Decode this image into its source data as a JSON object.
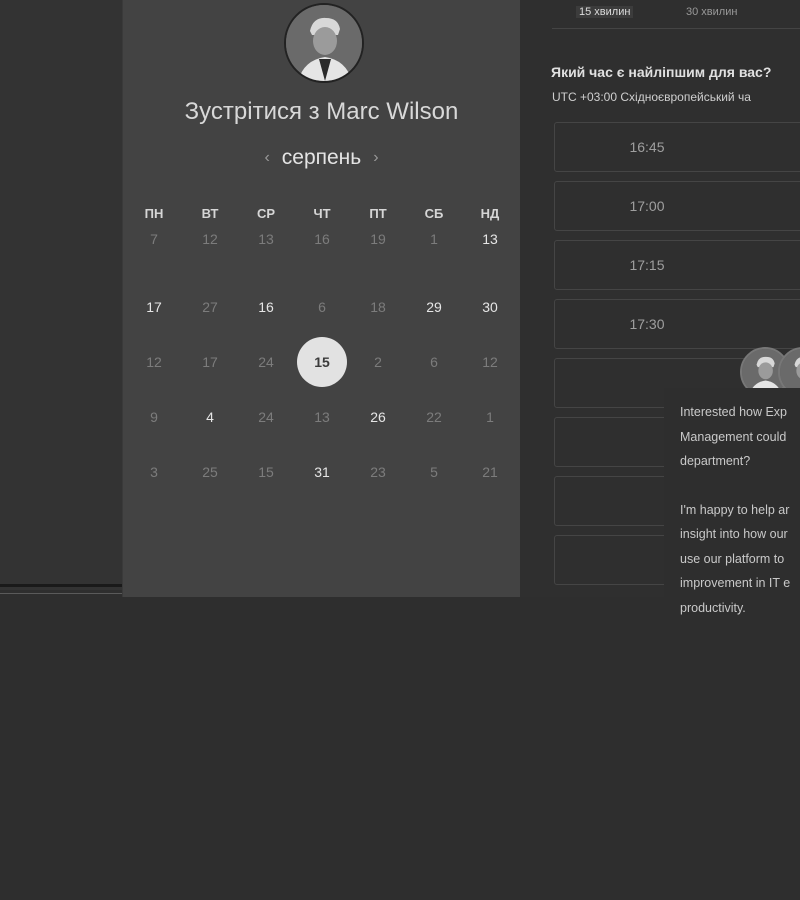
{
  "scheduler": {
    "title": "Зустрітися з Marc Wilson",
    "month": "серпень",
    "weekdays": [
      "ПН",
      "ВТ",
      "СР",
      "ЧТ",
      "ПТ",
      "СБ",
      "НД"
    ],
    "days": [
      [
        {
          "v": "7",
          "a": false
        },
        {
          "v": "12",
          "a": false
        },
        {
          "v": "13",
          "a": false
        },
        {
          "v": "16",
          "a": false
        },
        {
          "v": "19",
          "a": false
        },
        {
          "v": "1",
          "a": false
        },
        {
          "v": "13",
          "a": true
        }
      ],
      [
        {
          "v": "17",
          "a": true
        },
        {
          "v": "27",
          "a": false
        },
        {
          "v": "16",
          "a": true
        },
        {
          "v": "6",
          "a": false
        },
        {
          "v": "18",
          "a": false
        },
        {
          "v": "29",
          "a": true
        },
        {
          "v": "30",
          "a": true
        }
      ],
      [
        {
          "v": "12",
          "a": false
        },
        {
          "v": "17",
          "a": false
        },
        {
          "v": "24",
          "a": false
        },
        {
          "v": "15",
          "a": true,
          "selected": true
        },
        {
          "v": "2",
          "a": false
        },
        {
          "v": "6",
          "a": false
        },
        {
          "v": "12",
          "a": false
        }
      ],
      [
        {
          "v": "9",
          "a": false
        },
        {
          "v": "4",
          "a": true
        },
        {
          "v": "24",
          "a": false
        },
        {
          "v": "13",
          "a": false
        },
        {
          "v": "26",
          "a": true
        },
        {
          "v": "22",
          "a": false
        },
        {
          "v": "1",
          "a": false
        }
      ],
      [
        {
          "v": "3",
          "a": false
        },
        {
          "v": "25",
          "a": false
        },
        {
          "v": "15",
          "a": false
        },
        {
          "v": "31",
          "a": true
        },
        {
          "v": "23",
          "a": false
        },
        {
          "v": "5",
          "a": false
        },
        {
          "v": "21",
          "a": false
        }
      ]
    ]
  },
  "durations": {
    "active": "15 хвилин",
    "other": "30 хвилин"
  },
  "times": {
    "question": "Який час є найліпшим для вас?",
    "timezone": "UTC +03:00 Східноєвропейський ча",
    "slots": [
      "16:45",
      "17:00",
      "17:15",
      "17:30",
      "",
      "",
      "",
      ""
    ]
  },
  "chat": {
    "paragraph1": [
      "Interested how Exp",
      "Management could",
      "department?"
    ],
    "paragraph2": [
      "I'm happy to help ar",
      "insight into how our",
      "use our platform to",
      "improvement in IT e",
      "productivity."
    ]
  }
}
